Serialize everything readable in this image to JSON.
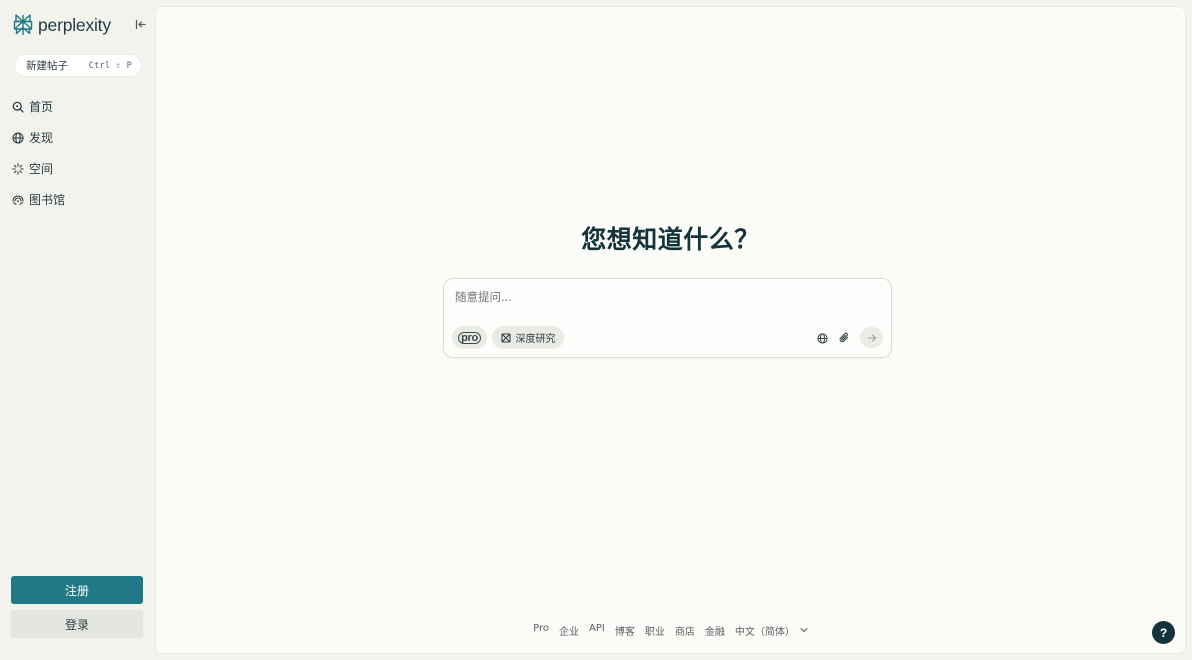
{
  "brand": {
    "name": "perplexity",
    "logo_icon": "perplexity-logo-icon",
    "color": "#217886"
  },
  "sidebar": {
    "collapse_icon": "collapse-sidebar-icon",
    "new_thread": {
      "label": "新建帖子",
      "shortcut": "Ctrl ⇧ P"
    },
    "items": [
      {
        "label": "首页",
        "icon": "search-icon"
      },
      {
        "label": "发现",
        "icon": "globe-icon"
      },
      {
        "label": "空间",
        "icon": "spaces-icon"
      },
      {
        "label": "图书馆",
        "icon": "library-icon"
      }
    ],
    "signup_label": "注册",
    "login_label": "登录"
  },
  "main": {
    "headline": "您想知道什么？",
    "search": {
      "placeholder": "随意提问...",
      "pro_label": "pro",
      "deep_research_label": "深度研究",
      "icons": [
        "globe-icon",
        "paperclip-icon",
        "arrow-right-icon"
      ]
    }
  },
  "footer": {
    "links": [
      "Pro",
      "企业",
      "API",
      "博客",
      "职业",
      "商店",
      "金融"
    ],
    "language": "中文（简体）"
  },
  "help_label": "?",
  "colors": {
    "accent": "#217886",
    "text": "#13343b",
    "background": "#f3f3ee",
    "panel": "#fbfbf8"
  }
}
